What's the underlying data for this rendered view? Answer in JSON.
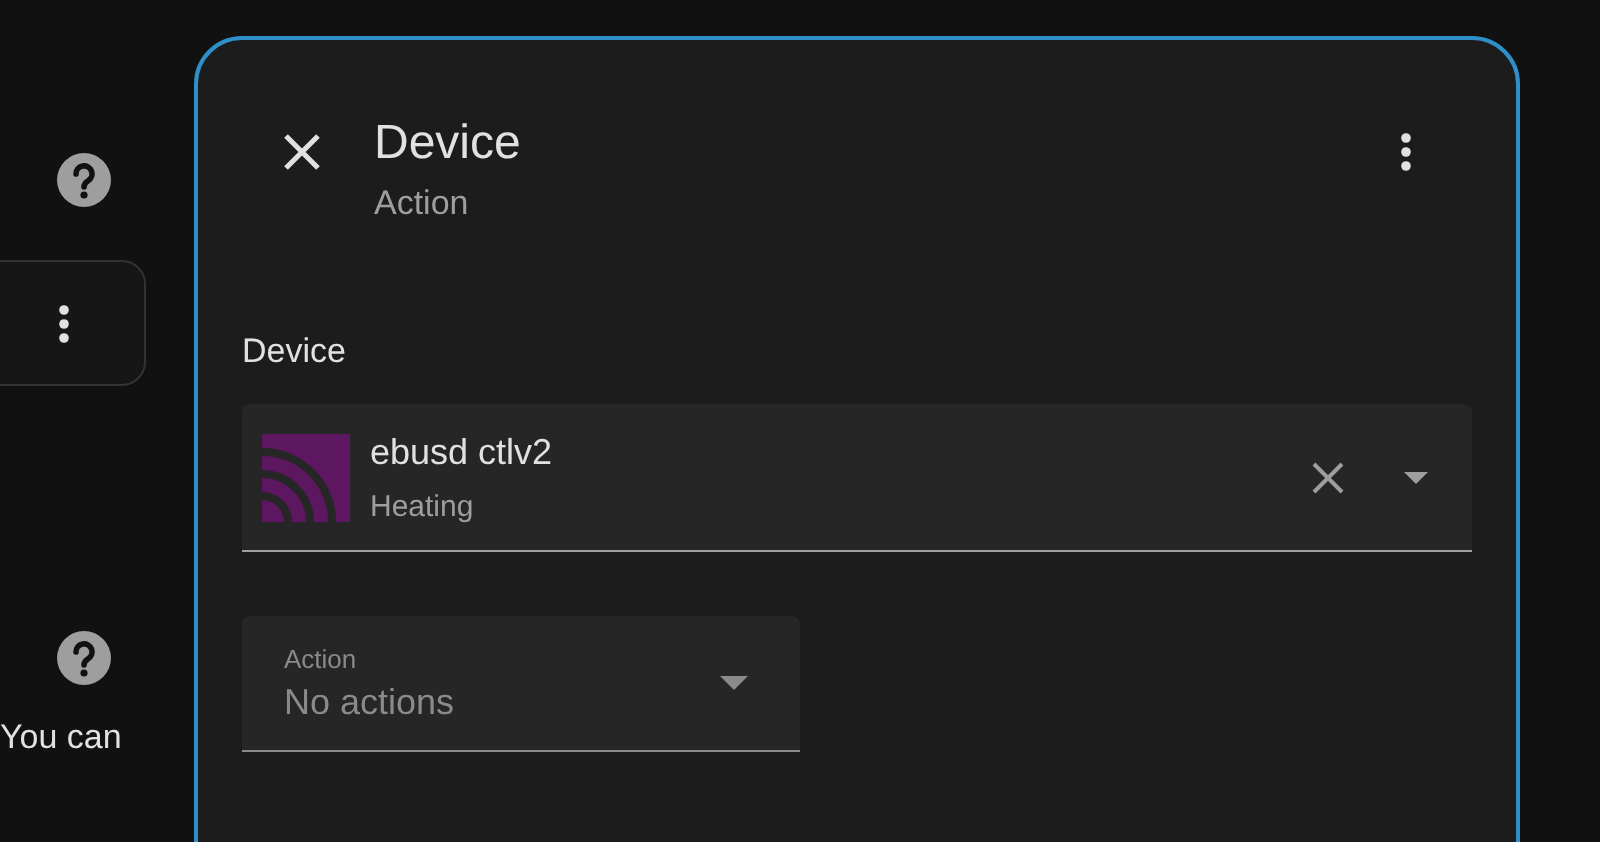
{
  "background_panel": {
    "hint_text": "You can"
  },
  "dialog": {
    "title": "Device",
    "subtitle": "Action",
    "device_label": "Device",
    "device_picker": {
      "name": "ebusd ctlv2",
      "area": "Heating"
    },
    "action_select": {
      "label": "Action",
      "value": "No actions",
      "disabled": true
    }
  }
}
